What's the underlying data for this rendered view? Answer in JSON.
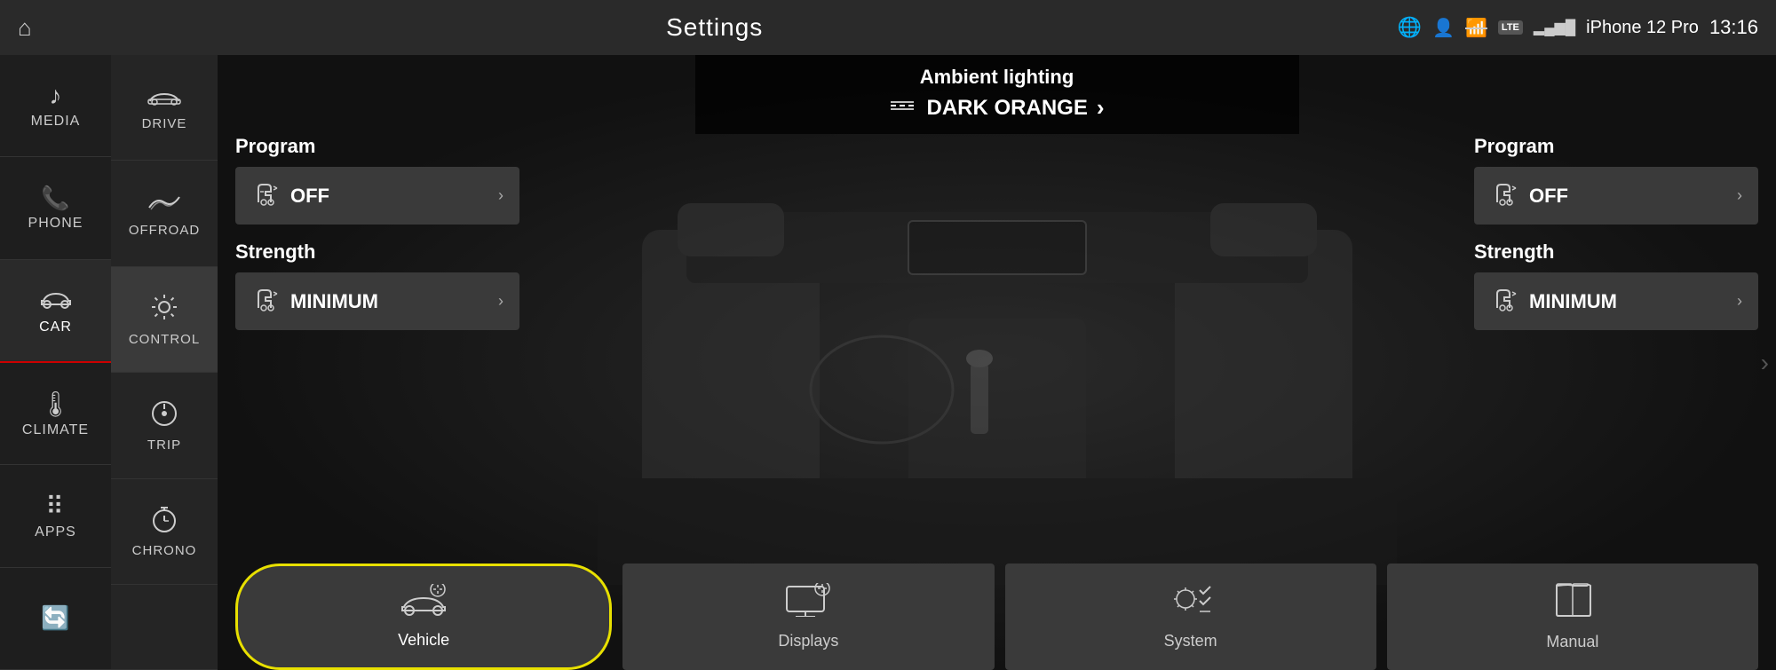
{
  "topbar": {
    "title": "Settings",
    "phone_name": "iPhone 12 Pro",
    "time": "13:16",
    "lte": "LTE"
  },
  "sidebar": {
    "items": [
      {
        "id": "media",
        "label": "MEDIA",
        "icon": "♪"
      },
      {
        "id": "phone",
        "label": "PHONE",
        "icon": "📞"
      },
      {
        "id": "car",
        "label": "CAR",
        "icon": "🚗",
        "active": true
      },
      {
        "id": "climate",
        "label": "CLIMATE",
        "icon": "🌡"
      },
      {
        "id": "apps",
        "label": "APPS",
        "icon": "⠿"
      }
    ]
  },
  "sidebar2": {
    "items": [
      {
        "id": "drive",
        "label": "DRIVE",
        "icon": "🚘"
      },
      {
        "id": "offroad",
        "label": "OFFROAD",
        "icon": "〰"
      },
      {
        "id": "control",
        "label": "CONTROL",
        "icon": "⚙",
        "active": true
      },
      {
        "id": "trip",
        "label": "TRIP",
        "icon": "◎"
      },
      {
        "id": "chrono",
        "label": "CHRONO",
        "icon": "⏰"
      }
    ]
  },
  "ambient": {
    "title": "Ambient lighting",
    "icon": "ambient-icon",
    "value": "DARK ORANGE",
    "chevron": "›"
  },
  "left_panel": {
    "program_title": "Program",
    "program_value": "OFF",
    "strength_title": "Strength",
    "strength_value": "MINIMUM"
  },
  "right_panel": {
    "program_title": "Program",
    "program_value": "OFF",
    "strength_title": "Strength",
    "strength_value": "MINIMUM"
  },
  "bottom_buttons": [
    {
      "id": "vehicle",
      "label": "Vehicle",
      "active": true
    },
    {
      "id": "displays",
      "label": "Displays",
      "active": false
    },
    {
      "id": "system",
      "label": "System",
      "active": false
    },
    {
      "id": "manual",
      "label": "Manual",
      "active": false
    }
  ],
  "chevron_right": "›"
}
